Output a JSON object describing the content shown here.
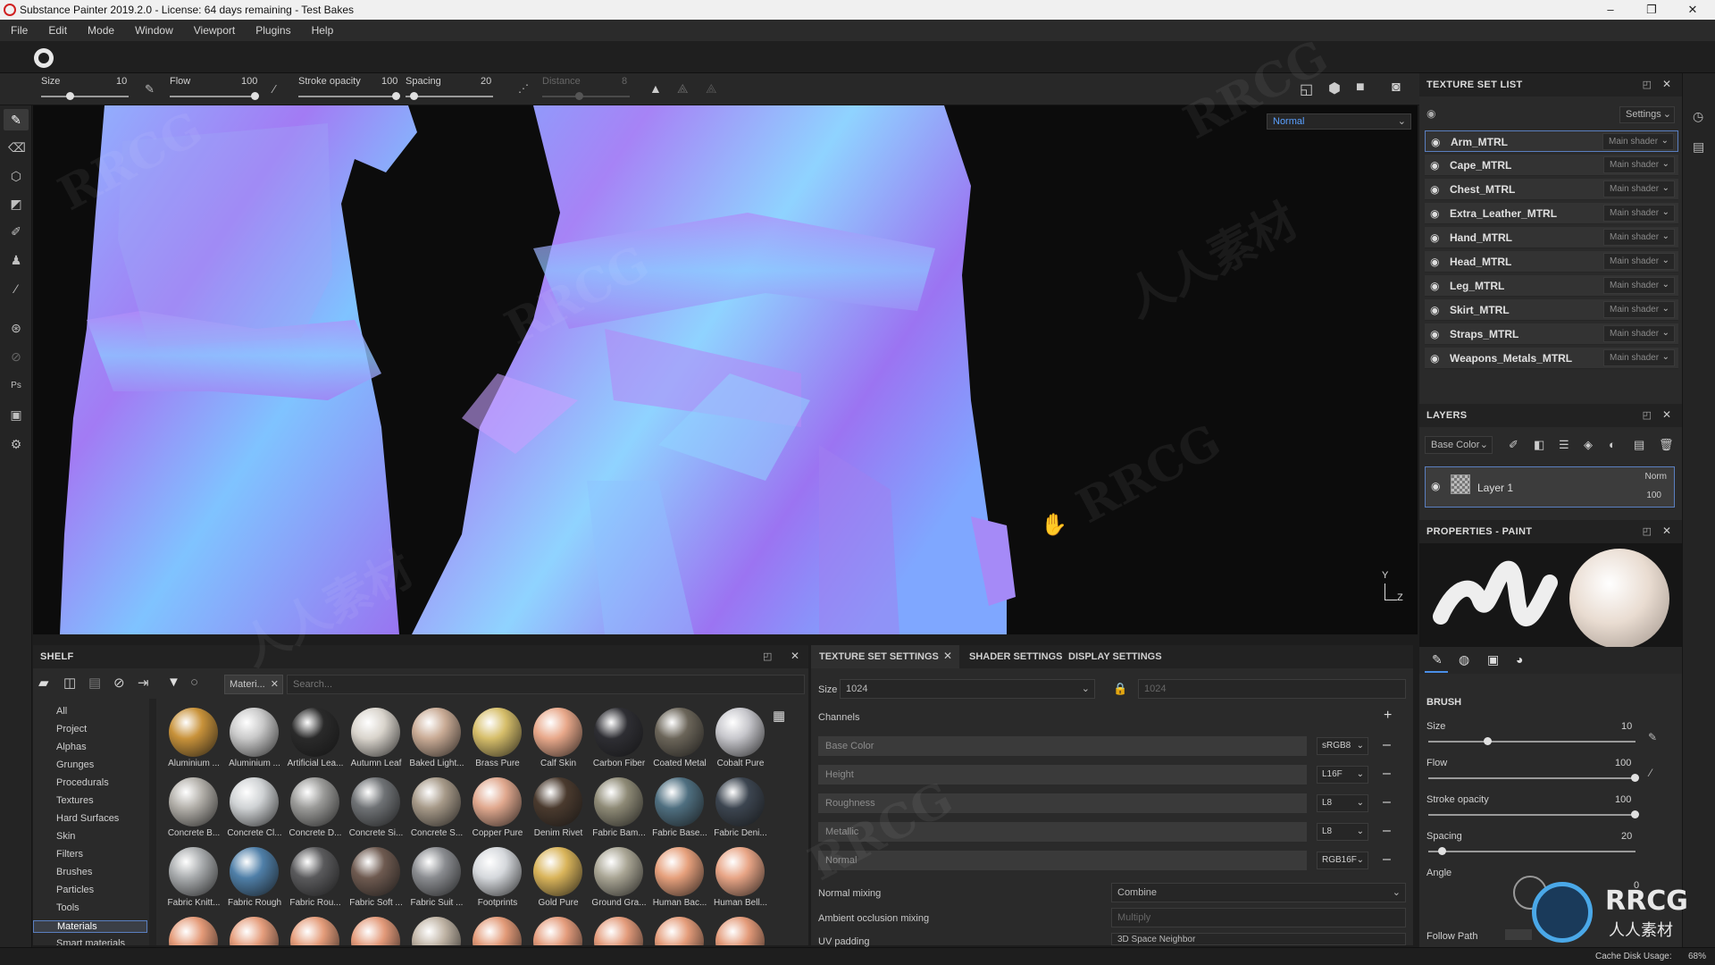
{
  "window": {
    "title": "Substance Painter 2019.2.0 - License: 64 days remaining - Test Bakes",
    "minimize": "–",
    "maximize": "❐",
    "close": "✕"
  },
  "menu": [
    "File",
    "Edit",
    "Mode",
    "Window",
    "Viewport",
    "Plugins",
    "Help"
  ],
  "toolbar": {
    "size_label": "Size",
    "size_value": "10",
    "flow_label": "Flow",
    "flow_value": "100",
    "stroke_opacity_label": "Stroke opacity",
    "stroke_opacity_value": "100",
    "spacing_label": "Spacing",
    "spacing_value": "20",
    "distance_label": "Distance",
    "distance_value": "8"
  },
  "viewport": {
    "display_mode": "Normal",
    "axis_y": "Y",
    "axis_z": "Z"
  },
  "texture_set_list": {
    "title": "TEXTURE SET LIST",
    "settings_label": "Settings",
    "items": [
      {
        "name": "Arm_MTRL",
        "shader": "Main shader"
      },
      {
        "name": "Cape_MTRL",
        "shader": "Main shader"
      },
      {
        "name": "Chest_MTRL",
        "shader": "Main shader"
      },
      {
        "name": "Extra_Leather_MTRL",
        "shader": "Main shader"
      },
      {
        "name": "Hand_MTRL",
        "shader": "Main shader"
      },
      {
        "name": "Head_MTRL",
        "shader": "Main shader"
      },
      {
        "name": "Leg_MTRL",
        "shader": "Main shader"
      },
      {
        "name": "Skirt_MTRL",
        "shader": "Main shader"
      },
      {
        "name": "Straps_MTRL",
        "shader": "Main shader"
      },
      {
        "name": "Weapons_Metals_MTRL",
        "shader": "Main shader"
      }
    ]
  },
  "layers": {
    "title": "LAYERS",
    "channel": "Base Color",
    "layer_name": "Layer 1",
    "blend": "Norm",
    "opacity": "100"
  },
  "properties": {
    "title": "PROPERTIES - PAINT",
    "brush_title": "BRUSH",
    "size_label": "Size",
    "size_value": "10",
    "flow_label": "Flow",
    "flow_value": "100",
    "stroke_opacity_label": "Stroke opacity",
    "stroke_opacity_value": "100",
    "spacing_label": "Spacing",
    "spacing_value": "20",
    "angle_label": "Angle",
    "angle_value": "0",
    "follow_path_label": "Follow Path"
  },
  "shelf": {
    "title": "SHELF",
    "filter_tag": "Materi...",
    "search_placeholder": "Search...",
    "categories": [
      "All",
      "Project",
      "Alphas",
      "Grunges",
      "Procedurals",
      "Textures",
      "Hard Surfaces",
      "Skin",
      "Filters",
      "Brushes",
      "Particles",
      "Tools",
      "Materials",
      "Smart materials"
    ],
    "selected_category": "Materials",
    "materials": [
      {
        "label": "Aluminium ...",
        "color": "#c8923a"
      },
      {
        "label": "Aluminium ...",
        "color": "#c9c9c9"
      },
      {
        "label": "Artificial Lea...",
        "color": "#2a2a2a"
      },
      {
        "label": "Autumn Leaf",
        "color": "#d9d4cc"
      },
      {
        "label": "Baked Light...",
        "color": "#c9ab95"
      },
      {
        "label": "Brass Pure",
        "color": "#d6be6a"
      },
      {
        "label": "Calf Skin",
        "color": "#e8a88a"
      },
      {
        "label": "Carbon Fiber",
        "color": "#2e2e33"
      },
      {
        "label": "Coated Metal",
        "color": "#6b6559"
      },
      {
        "label": "Cobalt Pure",
        "color": "#c7c7cc"
      },
      {
        "label": "Concrete B...",
        "color": "#b3b0aa"
      },
      {
        "label": "Concrete Cl...",
        "color": "#cfd2d4"
      },
      {
        "label": "Concrete D...",
        "color": "#9a9a98"
      },
      {
        "label": "Concrete Si...",
        "color": "#6f7275"
      },
      {
        "label": "Concrete S...",
        "color": "#a69988"
      },
      {
        "label": "Copper Pure",
        "color": "#e0a88e"
      },
      {
        "label": "Denim Rivet",
        "color": "#4a3a2e"
      },
      {
        "label": "Fabric Bam...",
        "color": "#8e8a76"
      },
      {
        "label": "Fabric Base...",
        "color": "#4f6f80"
      },
      {
        "label": "Fabric Deni...",
        "color": "#3c4550"
      },
      {
        "label": "Fabric Knitt...",
        "color": "#a9acae"
      },
      {
        "label": "Fabric Rough",
        "color": "#4f7fa8"
      },
      {
        "label": "Fabric Rou...",
        "color": "#5a5a5c"
      },
      {
        "label": "Fabric Soft ...",
        "color": "#6e5a50"
      },
      {
        "label": "Fabric Suit ...",
        "color": "#8a8c90"
      },
      {
        "label": "Footprints",
        "color": "#d5d8dc"
      },
      {
        "label": "Gold Pure",
        "color": "#d9b45a"
      },
      {
        "label": "Ground Gra...",
        "color": "#a9a594"
      },
      {
        "label": "Human Bac...",
        "color": "#e6a07c"
      },
      {
        "label": "Human Bell...",
        "color": "#e8a586"
      },
      {
        "label": "",
        "color": "#e49a78"
      },
      {
        "label": "",
        "color": "#e59d7c"
      },
      {
        "label": "",
        "color": "#e49c7a"
      },
      {
        "label": "",
        "color": "#e39a7a"
      },
      {
        "label": "",
        "color": "#bfb3a4"
      },
      {
        "label": "",
        "color": "#e29a78"
      },
      {
        "label": "",
        "color": "#e49c7c"
      },
      {
        "label": "",
        "color": "#e39b7b"
      },
      {
        "label": "",
        "color": "#e49c7a"
      },
      {
        "label": "",
        "color": "#e39a79"
      }
    ]
  },
  "texture_settings": {
    "tabs": [
      "TEXTURE SET SETTINGS",
      "SHADER SETTINGS",
      "DISPLAY SETTINGS"
    ],
    "size_label": "Size",
    "size_value": "1024",
    "size_value2": "1024",
    "channels_label": "Channels",
    "channels": [
      {
        "name": "Base Color",
        "format": "sRGB8"
      },
      {
        "name": "Height",
        "format": "L16F"
      },
      {
        "name": "Roughness",
        "format": "L8"
      },
      {
        "name": "Metallic",
        "format": "L8"
      },
      {
        "name": "Normal",
        "format": "RGB16F"
      }
    ],
    "normal_mixing_label": "Normal mixing",
    "normal_mixing_value": "Combine",
    "ao_mixing_label": "Ambient occlusion mixing",
    "ao_mixing_value": "Multiply",
    "uv_padding_label": "UV padding",
    "uv_padding_value": "3D Space Neighbor"
  },
  "status": {
    "cache_label": "Cache Disk Usage:",
    "cache_value": "68%"
  },
  "watermark": {
    "latin": "RRCG",
    "cjk": "人人素材"
  }
}
